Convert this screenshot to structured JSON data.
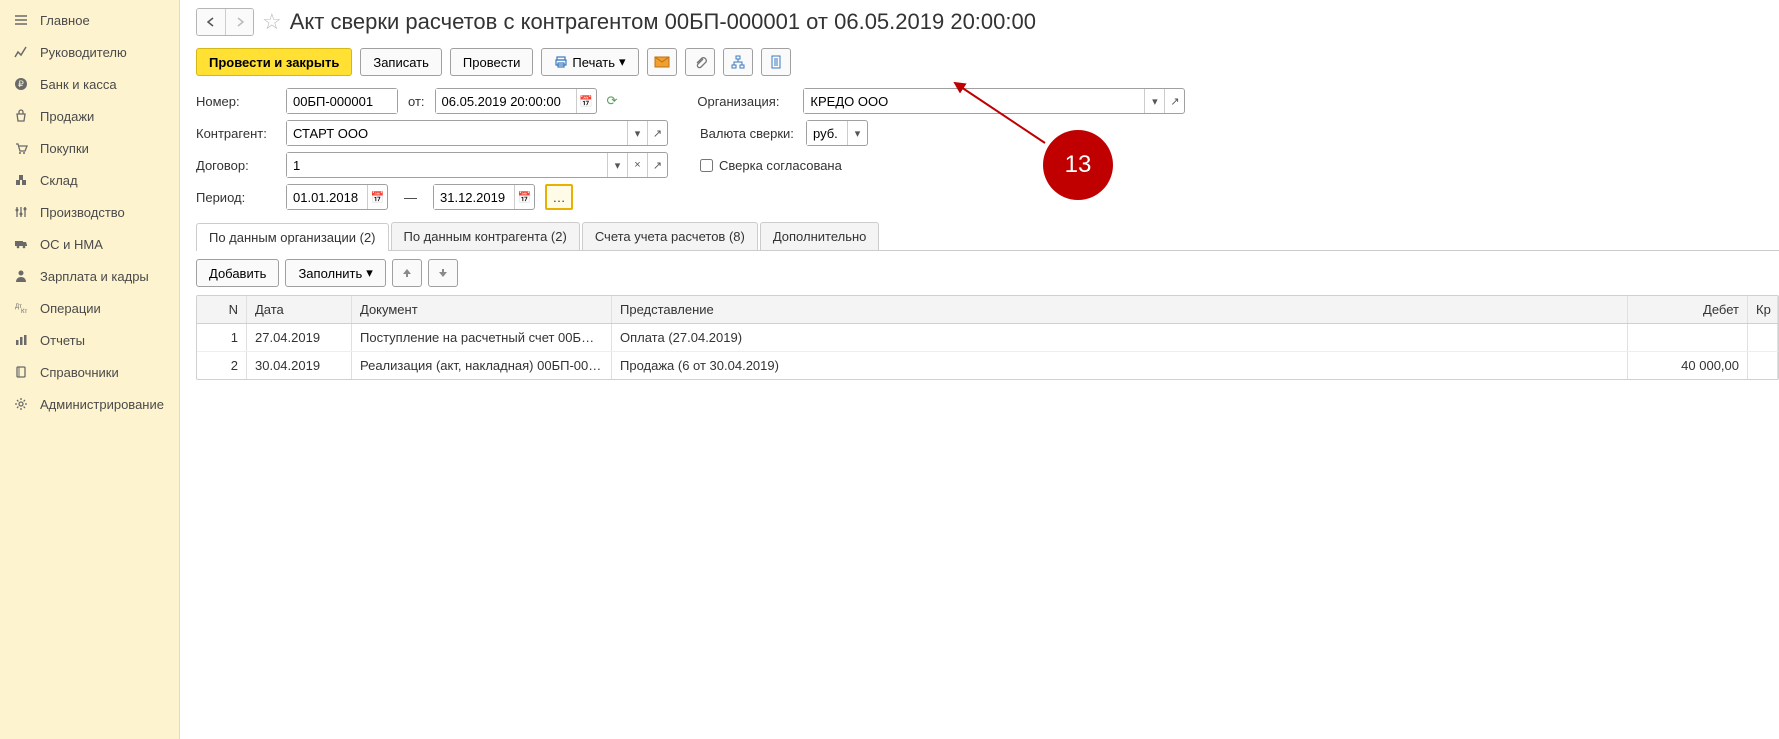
{
  "sidebar": {
    "items": [
      {
        "label": "Главное"
      },
      {
        "label": "Руководителю"
      },
      {
        "label": "Банк и касса"
      },
      {
        "label": "Продажи"
      },
      {
        "label": "Покупки"
      },
      {
        "label": "Склад"
      },
      {
        "label": "Производство"
      },
      {
        "label": "ОС и НМА"
      },
      {
        "label": "Зарплата и кадры"
      },
      {
        "label": "Операции"
      },
      {
        "label": "Отчеты"
      },
      {
        "label": "Справочники"
      },
      {
        "label": "Администрирование"
      }
    ]
  },
  "header": {
    "title": "Акт сверки расчетов с контрагентом 00БП-000001 от 06.05.2019 20:00:00"
  },
  "toolbar": {
    "post_close": "Провести и закрыть",
    "save": "Записать",
    "post": "Провести",
    "print": "Печать"
  },
  "form": {
    "number_label": "Номер:",
    "number_value": "00БП-000001",
    "from_label": "от:",
    "from_value": "06.05.2019 20:00:00",
    "org_label": "Организация:",
    "org_value": "КРЕДО ООО",
    "contragent_label": "Контрагент:",
    "contragent_value": "СТАРТ ООО",
    "currency_label": "Валюта сверки:",
    "currency_value": "руб.",
    "contract_label": "Договор:",
    "contract_value": "1",
    "checked_label": "Сверка согласована",
    "period_label": "Период:",
    "period_from": "01.01.2018",
    "period_to": "31.12.2019"
  },
  "tabs": [
    {
      "label": "По данным организации (2)"
    },
    {
      "label": "По данным контрагента (2)"
    },
    {
      "label": "Счета учета расчетов (8)"
    },
    {
      "label": "Дополнительно"
    }
  ],
  "subtoolbar": {
    "add": "Добавить",
    "fill": "Заполнить"
  },
  "table": {
    "headers": {
      "n": "N",
      "date": "Дата",
      "doc": "Документ",
      "pres": "Представление",
      "deb": "Дебет",
      "kr": "Кр"
    },
    "rows": [
      {
        "n": "1",
        "date": "27.04.2019",
        "doc": "Поступление на расчетный счет 00БП-...",
        "pres": "Оплата (27.04.2019)",
        "deb": ""
      },
      {
        "n": "2",
        "date": "30.04.2019",
        "doc": "Реализация (акт, накладная) 00БП-000...",
        "pres": "Продажа (6 от 30.04.2019)",
        "deb": "40 000,00"
      }
    ]
  },
  "callout": {
    "text": "13"
  }
}
